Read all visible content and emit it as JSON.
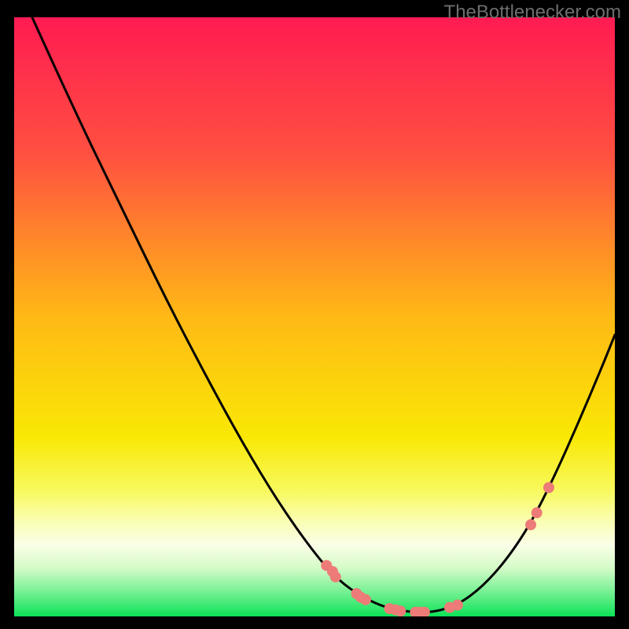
{
  "watermark": "TheBottlenecker.com",
  "chart_data": {
    "type": "line",
    "title": "",
    "xlabel": "",
    "ylabel": "",
    "xlim": [
      0,
      100
    ],
    "ylim": [
      0,
      100
    ],
    "gradient_stops": [
      {
        "offset": 0,
        "color": "#ff1b52"
      },
      {
        "offset": 23,
        "color": "#ff5140"
      },
      {
        "offset": 50,
        "color": "#ffb915"
      },
      {
        "offset": 70,
        "color": "#f9e805"
      },
      {
        "offset": 79,
        "color": "#f8f95e"
      },
      {
        "offset": 84,
        "color": "#fafeb1"
      },
      {
        "offset": 88,
        "color": "#fbfee7"
      },
      {
        "offset": 92,
        "color": "#d3fbc7"
      },
      {
        "offset": 96,
        "color": "#73f091"
      },
      {
        "offset": 100,
        "color": "#0ce358"
      }
    ],
    "curve_points": [
      {
        "x": 3.0,
        "y": 100.0
      },
      {
        "x": 10.0,
        "y": 84.5
      },
      {
        "x": 18.0,
        "y": 68.0
      },
      {
        "x": 25.0,
        "y": 53.5
      },
      {
        "x": 32.0,
        "y": 40.0
      },
      {
        "x": 38.0,
        "y": 29.0
      },
      {
        "x": 44.0,
        "y": 19.0
      },
      {
        "x": 50.0,
        "y": 10.5
      },
      {
        "x": 54.0,
        "y": 6.0
      },
      {
        "x": 58.0,
        "y": 3.2
      },
      {
        "x": 62.0,
        "y": 1.4
      },
      {
        "x": 66.0,
        "y": 0.7
      },
      {
        "x": 70.0,
        "y": 0.7
      },
      {
        "x": 74.0,
        "y": 2.0
      },
      {
        "x": 78.0,
        "y": 5.0
      },
      {
        "x": 82.0,
        "y": 9.5
      },
      {
        "x": 86.0,
        "y": 15.5
      },
      {
        "x": 90.0,
        "y": 23.5
      },
      {
        "x": 94.0,
        "y": 32.5
      },
      {
        "x": 98.0,
        "y": 42.0
      },
      {
        "x": 100.0,
        "y": 47.0
      }
    ],
    "marker_points": [
      {
        "x": 52.0,
        "y": 8.5
      },
      {
        "x": 53.0,
        "y": 7.5
      },
      {
        "x": 53.5,
        "y": 6.6
      },
      {
        "x": 57.0,
        "y": 3.8
      },
      {
        "x": 57.7,
        "y": 3.2
      },
      {
        "x": 58.5,
        "y": 2.8
      },
      {
        "x": 62.5,
        "y": 1.3
      },
      {
        "x": 63.5,
        "y": 1.1
      },
      {
        "x": 64.3,
        "y": 0.9
      },
      {
        "x": 66.8,
        "y": 0.7
      },
      {
        "x": 67.5,
        "y": 0.7
      },
      {
        "x": 68.3,
        "y": 0.7
      },
      {
        "x": 72.5,
        "y": 1.5
      },
      {
        "x": 73.8,
        "y": 1.9
      },
      {
        "x": 86.0,
        "y": 15.3
      },
      {
        "x": 87.0,
        "y": 17.3
      },
      {
        "x": 89.0,
        "y": 21.5
      }
    ],
    "marker_color": "#ed7c78",
    "marker_radius": 7
  }
}
